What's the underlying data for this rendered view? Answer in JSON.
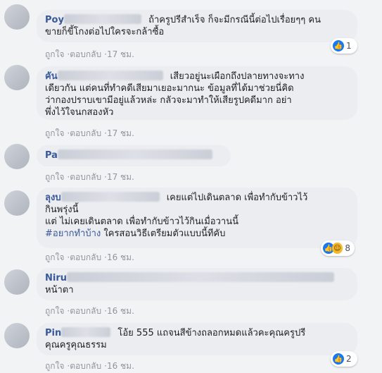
{
  "labels": {
    "like": "ถูกใจ",
    "reply": "ตอบกลับ",
    "sep": "·"
  },
  "comments": [
    {
      "name": "Poy",
      "text1": "ถ้าครูปรีสำเร็จ ก็จะมีกรณีนี้ต่อไปเรื่อยๆๆ คน",
      "text2": "ขายก็ขี้โกงต่อไปใครจะกล้าซื้อ",
      "time": "17 ชม.",
      "reactions": "1"
    },
    {
      "name": "คัน",
      "text1": "เสียวอยู่นะเผือกถึงปลายทางจะทาง",
      "text2": "เดียวกัน แต่คนที่ทำคดีเสียมาเยอะมากนะ ข้อมูลที่ได้มาช่วยนี่คิด",
      "text3": "ว่ากองปราบเขามีอยู่แล้วหล่ะ กลัวจะมาทำให้เสียรูปคดีมาก อย่า",
      "text4": "พึ่งไว้ใจนกสองหัว",
      "time": "17 ชม."
    },
    {
      "name": "Pa",
      "time": "17 ชม."
    },
    {
      "name": "ลุงบ",
      "text1": "เคยแต่ไปเดินตลาด เพื่อทำกับข้าวไว้",
      "text2": "กินพรุ่งนี้",
      "text3": "แต่ ไม่เคยเดินตลาด เพื่อทำกับข้าวไว้กินเมื่อวานนี้",
      "hashtag": "#อยากทำบ้าง",
      "text4": "ใครสอนวิธีเตรียมตัวแบบนี้ทีคับ",
      "time": "16 ชม.",
      "reactions": "8"
    },
    {
      "name": "Niru",
      "text1": "หน้าตา",
      "time": "16 ชม."
    },
    {
      "name": "Pin",
      "text1": "โอ้ย 555 แถจนสีข้างถลอกหมดแล้วคะคุณครูปรี",
      "text2": "คุณครูคุณธรรม",
      "time": "16 ชม.",
      "reactions": "2"
    }
  ],
  "colors": {
    "link": "#385898",
    "bubble": "#ebedf0",
    "bg": "#f2f3f5",
    "like": "#1877f2"
  }
}
